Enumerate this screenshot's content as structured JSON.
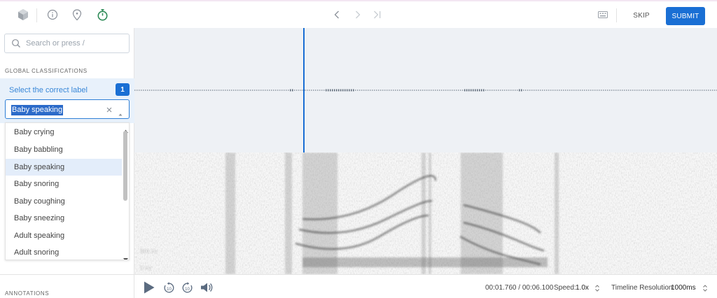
{
  "toolbar": {
    "icons": [
      "cube-icon",
      "info-icon",
      "location-pin-icon",
      "stopwatch-icon"
    ],
    "skip_label": "SKIP",
    "submit_label": "SUBMIT"
  },
  "search": {
    "placeholder": "Search or press /"
  },
  "global_classifications": {
    "title": "GLOBAL CLASSIFICATIONS",
    "question": "Select the correct label",
    "badge": "1",
    "selected_value": "Baby speaking",
    "options": [
      "Baby crying",
      "Baby babbling",
      "Baby speaking",
      "Baby snoring",
      "Baby coughing",
      "Baby sneezing",
      "Adult speaking",
      "Adult snoring"
    ],
    "selected_index": 2
  },
  "annotations": {
    "title": "ANNOTATIONS"
  },
  "spectrogram": {
    "freq_labels": [
      "800 Hz",
      "0 Hz"
    ]
  },
  "playback": {
    "time": "00:01.760 / 00:06.100",
    "speed_label": "Speed:",
    "speed_value": "1.0x",
    "resolution_label": "Timeline Resolution:",
    "resolution_value": "1000ms",
    "skip_back_label": "10",
    "skip_forward_label": "10"
  },
  "colors": {
    "accent": "#1a6fd4",
    "highlight": "#e8f1fb",
    "waveform_bg": "#eef1f5",
    "stopwatch": "#2e8b57"
  }
}
